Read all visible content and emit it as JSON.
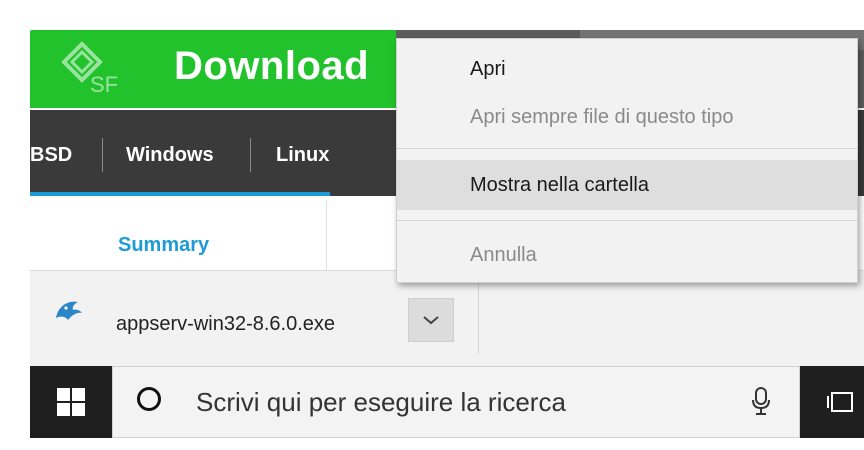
{
  "banner": {
    "title": "Download",
    "logo_text": "SF"
  },
  "nav": {
    "items": [
      "BSD",
      "Windows",
      "Linux"
    ]
  },
  "tabs": {
    "summary": "Summary"
  },
  "download_bar": {
    "file_name": "appserv-win32-8.6.0.exe"
  },
  "taskbar": {
    "search_placeholder": "Scrivi qui per eseguire la ricerca"
  },
  "context_menu": {
    "items": [
      {
        "label": "Apri",
        "enabled": true
      },
      {
        "label": "Apri sempre file di questo tipo",
        "enabled": false
      },
      {
        "label": "Mostra nella cartella",
        "enabled": true,
        "highlighted": true
      },
      {
        "label": "Annulla",
        "enabled": false
      }
    ]
  },
  "colors": {
    "banner_green": "#21c22b",
    "nav_dark": "#3a3a3a",
    "accent_blue": "#1d9bd7",
    "menu_bg": "#f2f2f2",
    "taskbar": "#1f1f1f"
  },
  "icons": [
    "sf-logo-icon",
    "file-icon",
    "chevron-down-icon",
    "windows-start-icon",
    "cortana-icon",
    "microphone-icon",
    "task-view-icon"
  ]
}
